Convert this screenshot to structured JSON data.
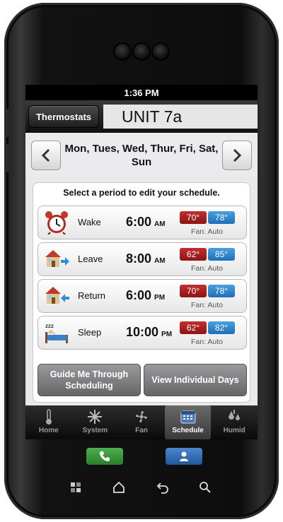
{
  "status_bar": {
    "time": "1:36 PM"
  },
  "header": {
    "thermostats_button": "Thermostats",
    "unit_title": "UNIT 7a"
  },
  "days_selector": {
    "days": "Mon, Tues, Wed, Thur, Fri, Sat, Sun"
  },
  "schedule": {
    "instruction": "Select a period to edit your schedule.",
    "periods": [
      {
        "label": "Wake",
        "time": "6:00",
        "ampm": "AM",
        "heat": "70°",
        "cool": "78°",
        "fan": "Fan: Auto",
        "icon": "alarm-clock-icon"
      },
      {
        "label": "Leave",
        "time": "8:00",
        "ampm": "AM",
        "heat": "62°",
        "cool": "85°",
        "fan": "Fan: Auto",
        "icon": "house-leave-icon"
      },
      {
        "label": "Return",
        "time": "6:00",
        "ampm": "PM",
        "heat": "70°",
        "cool": "78°",
        "fan": "Fan: Auto",
        "icon": "house-return-icon"
      },
      {
        "label": "Sleep",
        "time": "10:00",
        "ampm": "PM",
        "heat": "62°",
        "cool": "82°",
        "fan": "Fan: Auto",
        "icon": "sleep-bed-icon"
      }
    ],
    "guide_button": "Guide Me Through Scheduling",
    "view_days_button": "View Individual Days"
  },
  "tabs": [
    {
      "label": "Home",
      "icon": "thermometer-icon"
    },
    {
      "label": "System",
      "icon": "snowflake-sun-icon"
    },
    {
      "label": "Fan",
      "icon": "fan-icon"
    },
    {
      "label": "Schedule",
      "icon": "calendar-icon",
      "active": true
    },
    {
      "label": "Humid",
      "icon": "humidity-drops-icon"
    }
  ],
  "colors": {
    "heat": "#a71d1d",
    "cool": "#2a84cf",
    "call_green": "#3a9a3a",
    "contacts_blue": "#2f6fb6"
  }
}
